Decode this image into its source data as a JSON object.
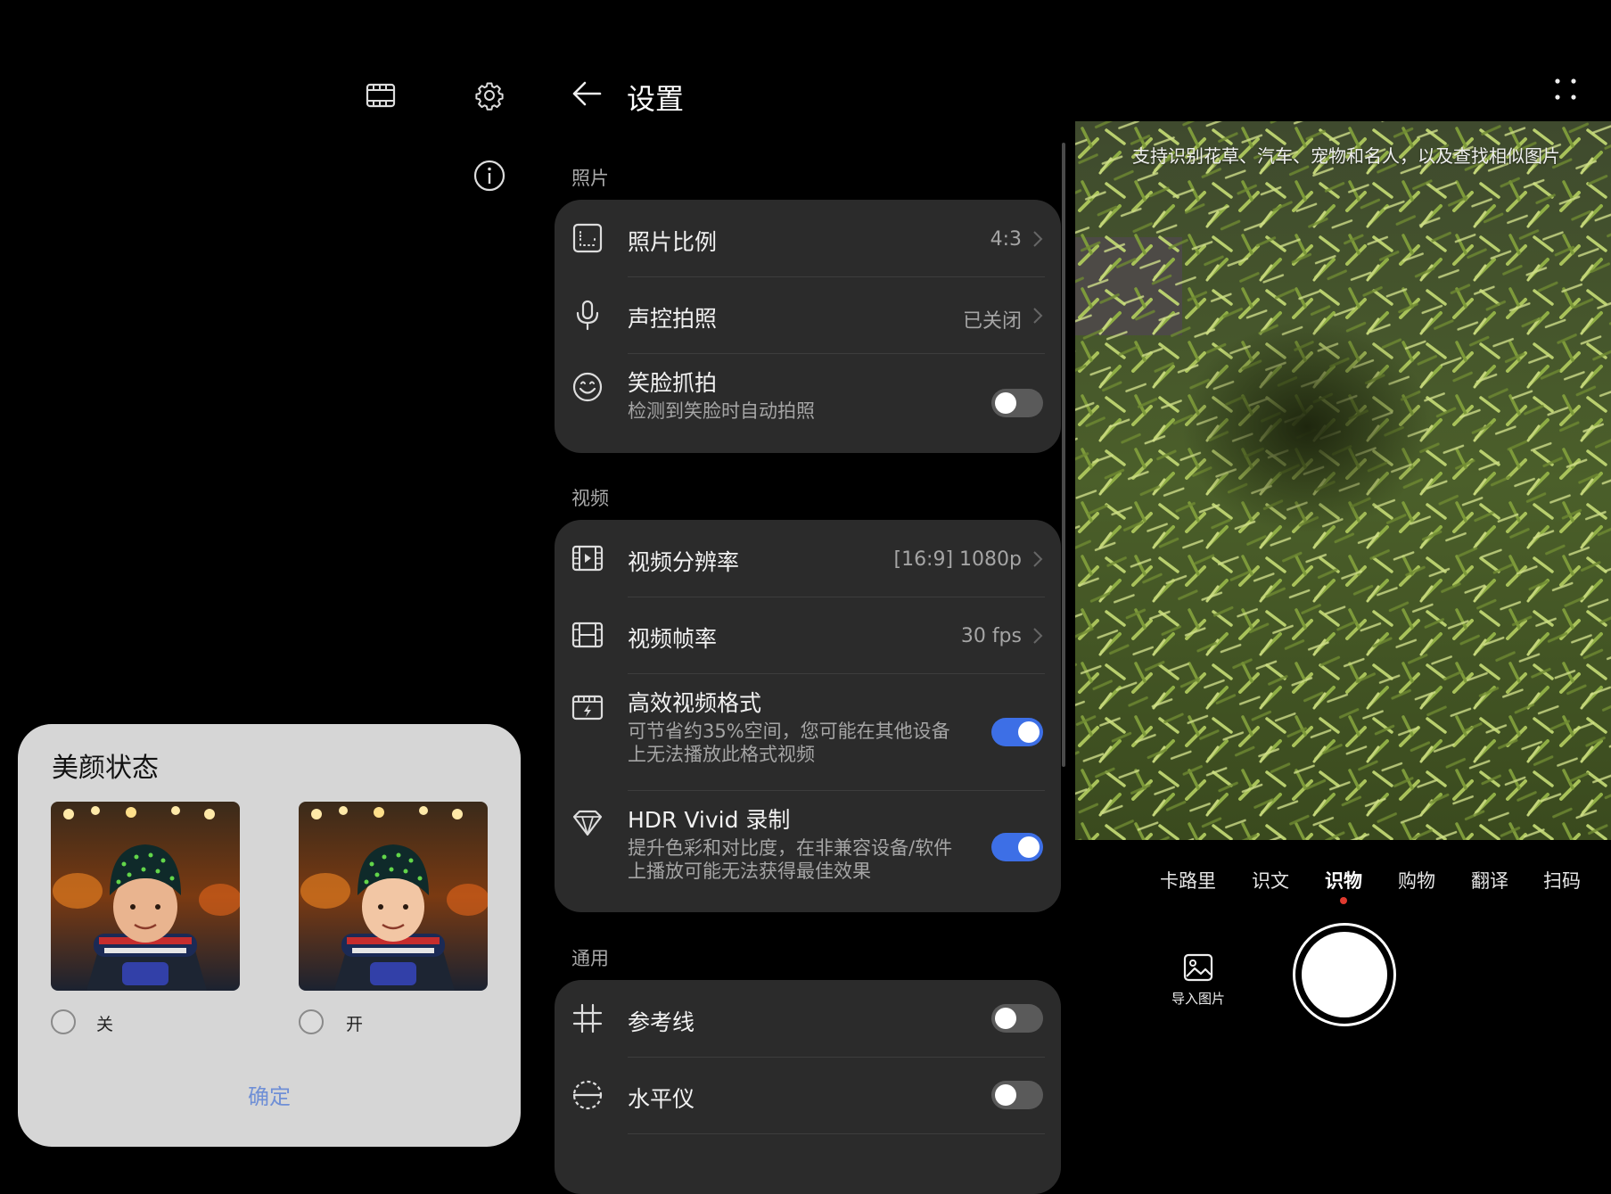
{
  "left_panel": {
    "beauty_dialog": {
      "title": "美颜状态",
      "options": [
        {
          "label": "关",
          "selected": false
        },
        {
          "label": "开",
          "selected": false
        }
      ],
      "confirm_label": "确定"
    }
  },
  "settings": {
    "title": "设置",
    "sections": [
      {
        "label": "照片",
        "rows": [
          {
            "title": "照片比例",
            "value": "4:3",
            "icon": "aspect-ratio-icon"
          },
          {
            "title": "声控拍照",
            "value": "已关闭",
            "icon": "microphone-icon"
          },
          {
            "title": "笑脸抓拍",
            "subtitle": "检测到笑脸时自动拍照",
            "toggle": false,
            "icon": "smile-icon"
          }
        ]
      },
      {
        "label": "视频",
        "rows": [
          {
            "title": "视频分辨率",
            "value": "[16:9] 1080p",
            "icon": "video-resolution-icon"
          },
          {
            "title": "视频帧率",
            "value": "30 fps",
            "icon": "film-frame-icon"
          },
          {
            "title": "高效视频格式",
            "subtitle": "可节省约35%空间，您可能在其他设备上无法播放此格式视频",
            "toggle": true,
            "icon": "efficient-video-icon"
          },
          {
            "title": "HDR Vivid 录制",
            "subtitle": "提升色彩和对比度，在非兼容设备/软件上播放可能无法获得最佳效果",
            "toggle": true,
            "icon": "hdr-diamond-icon"
          }
        ]
      },
      {
        "label": "通用",
        "rows": [
          {
            "title": "参考线",
            "toggle": false,
            "icon": "grid-icon"
          },
          {
            "title": "水平仪",
            "toggle": false,
            "icon": "level-icon"
          }
        ]
      }
    ]
  },
  "camera": {
    "hint": "支持识别花草、汽车、宠物和名人，以及查找相似图片",
    "modes": [
      "卡路里",
      "识文",
      "识物",
      "购物",
      "翻译",
      "扫码"
    ],
    "active_mode": "识物",
    "import_label": "导入图片"
  },
  "colors": {
    "toggle_on": "#3d6fe6",
    "card_bg": "#2b2b2b",
    "dialog_bg": "#d6d6d6",
    "confirm_text": "#6f8fd6",
    "active_dot": "#e03a2f"
  }
}
